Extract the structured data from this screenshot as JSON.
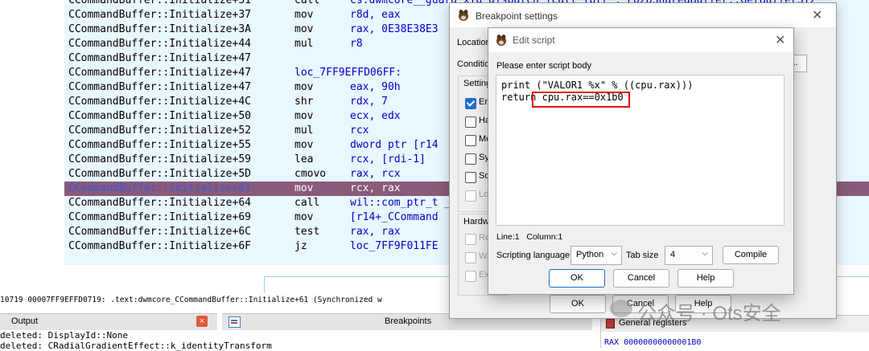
{
  "disasm": {
    "rows": [
      {
        "name": "CCommandBuffer::Initialize+31",
        "mn": "call",
        "op": "cs:dwmcore__guard_xfg_dispatch_icall_fptr  ; FD2DSharedBuffer::GetBufferSiz"
      },
      {
        "name": "CCommandBuffer::Initialize+37",
        "mn": "mov",
        "op": "r8d, eax"
      },
      {
        "name": "CCommandBuffer::Initialize+3A",
        "mn": "mov",
        "op": "rax, 0E38E38E3"
      },
      {
        "name": "CCommandBuffer::Initialize+44",
        "mn": "mul",
        "op": "r8"
      },
      {
        "name": "CCommandBuffer::Initialize+47",
        "mn": "",
        "op": ""
      },
      {
        "name": "CCommandBuffer::Initialize+47",
        "label": "loc_7FF9EFFD06FF:"
      },
      {
        "name": "CCommandBuffer::Initialize+47",
        "mn": "mov",
        "op": "eax, 90h"
      },
      {
        "name": "CCommandBuffer::Initialize+4C",
        "mn": "shr",
        "op": "rdx, 7"
      },
      {
        "name": "CCommandBuffer::Initialize+50",
        "mn": "mov",
        "op": "ecx, edx"
      },
      {
        "name": "CCommandBuffer::Initialize+52",
        "mn": "mul",
        "op": "rcx"
      },
      {
        "name": "CCommandBuffer::Initialize+55",
        "mn": "mov",
        "op": "dword ptr [r14"
      },
      {
        "name": "CCommandBuffer::Initialize+59",
        "mn": "lea",
        "op": "rcx, [rdi-1]"
      },
      {
        "name": "CCommandBuffer::Initialize+5D",
        "mn": "cmovo",
        "op": "rax, rcx"
      },
      {
        "name": "CCommandBuffer::Initialize+61",
        "mn": "mov",
        "op": "rcx, rax",
        "highlight": true
      },
      {
        "name": "CCommandBuffer::Initialize+64",
        "mn": "call",
        "op": "wil::com_ptr_t                                                     _ptr_t"
      },
      {
        "name": "CCommandBuffer::Initialize+69",
        "mn": "mov",
        "op": "[r14+_CCommand"
      },
      {
        "name": "CCommandBuffer::Initialize+6C",
        "mn": "test",
        "op": "rax, rax"
      },
      {
        "name": "CCommandBuffer::Initialize+6F",
        "mn": "jz",
        "op": "loc_7FF9F011FE"
      }
    ]
  },
  "status_line": "10719 00007FF9EFFD0719: .text:dwmcore_CCommandBuffer::Initialize+61 (Synchronized w",
  "output": {
    "title": "Output",
    "close_glyph": "×",
    "lines": [
      "deleted: DisplayId::None",
      "deleted: CRadialGradientEffect::k_identityTransform"
    ]
  },
  "breakpoints_tab": {
    "title": "Breakpoints"
  },
  "registers": {
    "title": "General registers",
    "rax": "RAX 00000000000001B0"
  },
  "bp_settings": {
    "title": "Breakpoint settings",
    "close_glyph": "✕",
    "location_label": "Location",
    "condition_label": "Condition",
    "dots_button": "...",
    "settings_group": "Setting",
    "checkboxes": [
      {
        "label": "En",
        "checked": true,
        "disabled": false
      },
      {
        "label": "Ha",
        "checked": false,
        "disabled": false
      },
      {
        "label": "Mo",
        "checked": false,
        "disabled": false
      },
      {
        "label": "Sy",
        "checked": false,
        "disabled": false
      },
      {
        "label": "So",
        "checked": false,
        "disabled": false
      },
      {
        "label": "Lo",
        "checked": false,
        "disabled": true
      }
    ],
    "hardware_group": "Hardw",
    "hw_checkboxes": [
      {
        "label": "Re",
        "disabled": true
      },
      {
        "label": "Wr",
        "disabled": true
      },
      {
        "label": "Ex",
        "disabled": true
      }
    ],
    "ok": "OK",
    "cancel": "Cancel",
    "help": "Help"
  },
  "edit_script": {
    "title": "Edit script",
    "close_glyph": "✕",
    "prompt": "Please enter script body",
    "code_line1": "print (\"VALOR1 %x\" % ((cpu.rax)))",
    "code_line2_prefix": "return",
    "code_line2_highlight": "cpu.rax==0x1b0",
    "line_label": "Line:1",
    "column_label": "Column:1",
    "lang_label": "Scripting language",
    "lang_value": "Python",
    "tab_label": "Tab size",
    "tab_value": "4",
    "compile": "Compile",
    "ok": "OK",
    "cancel": "Cancel",
    "help": "Help"
  },
  "watermark": {
    "text": "公众号 · Ots安全"
  },
  "colors": {
    "listing_bg": "#e9f7ff",
    "highlight_row": "#8a5a7a",
    "operand_blue": "#0000c8",
    "accent": "#1f6fd0",
    "marker_red": "#e01010"
  }
}
